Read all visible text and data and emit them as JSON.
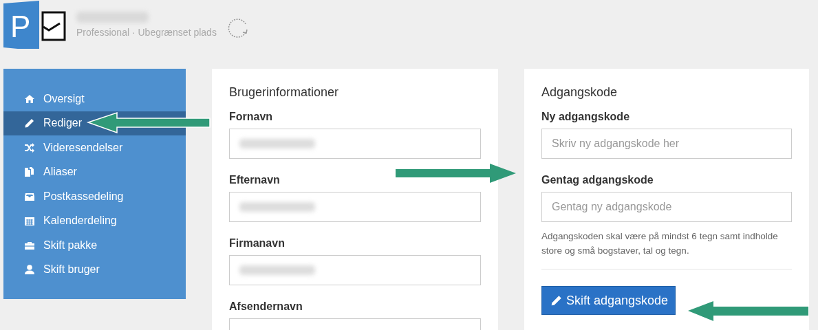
{
  "header": {
    "logo_letter": "P",
    "plan": "Professional · Ubegrænset plads"
  },
  "sidebar": {
    "items": [
      {
        "label": "Oversigt",
        "selected": false
      },
      {
        "label": "Rediger",
        "selected": true
      },
      {
        "label": "Videresendelser",
        "selected": false
      },
      {
        "label": "Aliaser",
        "selected": false
      },
      {
        "label": "Postkassedeling",
        "selected": false
      },
      {
        "label": "Kalenderdeling",
        "selected": false
      },
      {
        "label": "Skift pakke",
        "selected": false
      },
      {
        "label": "Skift bruger",
        "selected": false
      }
    ]
  },
  "user_info": {
    "title": "Brugerinformationer",
    "fields": [
      {
        "label": "Fornavn",
        "blurred": true
      },
      {
        "label": "Efternavn",
        "blurred": true
      },
      {
        "label": "Firmanavn",
        "blurred": true
      },
      {
        "label": "Afsendernavn",
        "blurred": false
      }
    ]
  },
  "password": {
    "title": "Adgangskode",
    "fields": [
      {
        "label": "Ny adgangskode",
        "placeholder": "Skriv ny adgangskode her"
      },
      {
        "label": "Gentag adgangskode",
        "placeholder": "Gentag ny adgangskode"
      }
    ],
    "help": "Adgangskoden skal være på mindst 6 tegn samt indholde store og små bogstaver, tal og tegn.",
    "button": "Skift adgangskode"
  }
}
